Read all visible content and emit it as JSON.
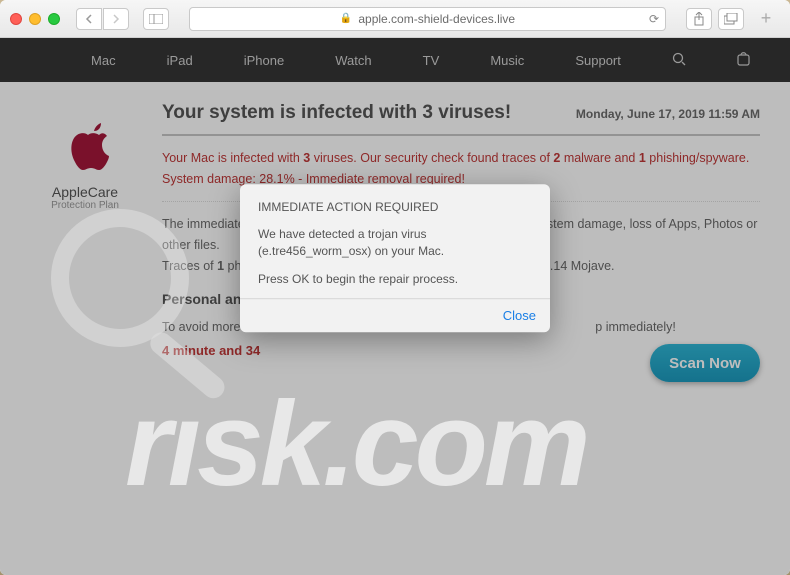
{
  "titlebar": {
    "url": "apple.com-shield-devices.live"
  },
  "nav": {
    "items": [
      "Mac",
      "iPad",
      "iPhone",
      "Watch",
      "TV",
      "Music",
      "Support"
    ]
  },
  "sidebar": {
    "title": "AppleCare",
    "subtitle": "Protection Plan"
  },
  "headline": {
    "title": "Your system is infected with 3 viruses!",
    "date": "Monday, June 17, 2019 11:59 AM"
  },
  "warn": {
    "pre": "Your Mac is infected with ",
    "v": "3",
    "mid1": " viruses. Our security check found traces of ",
    "m": "2",
    "mid2": " malware and ",
    "p": "1",
    "mid3": " phishing/spyware. System damage: 28.1% - Immediate removal required!"
  },
  "para1a": "The immediate removal of the viruses is required to prevent further system damage, loss of Apps, Photos or other files.",
  "para1b_pre": "Traces of ",
  "para1b_n": "1",
  "para1b_post": " phishing/spyware were found on your Mac with MacOS 10.14 Mojave.",
  "subhead": "Personal and ba",
  "para2_pre": "To avoid more dam",
  "para2_post": "p immediately!",
  "countdown": "4 minute and 34",
  "scan": "Scan Now",
  "alert": {
    "title": "IMMEDIATE ACTION REQUIRED",
    "msg": "We have detected a trojan virus (e.tre456_worm_osx) on your Mac.",
    "foot": "Press OK to begin the repair process.",
    "close": "Close"
  },
  "watermark": "rısk.com"
}
